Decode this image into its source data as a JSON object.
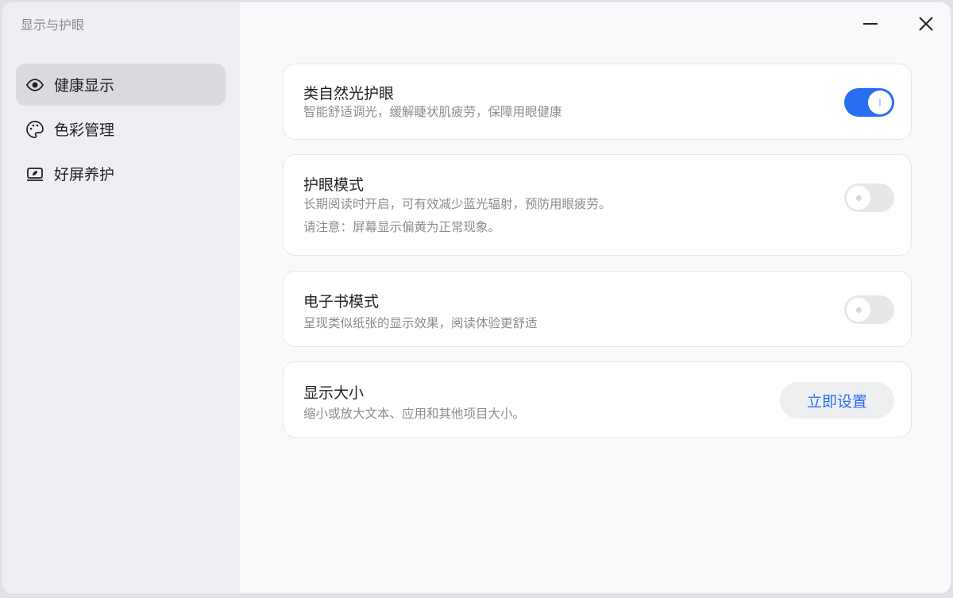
{
  "app": {
    "title": "显示与护眼"
  },
  "sidebar": {
    "items": [
      {
        "label": "健康显示",
        "icon": "eye-icon"
      },
      {
        "label": "色彩管理",
        "icon": "palette-icon"
      },
      {
        "label": "好屏养护",
        "icon": "screen-care-icon"
      }
    ]
  },
  "cards": [
    {
      "title": "类自然光护眼",
      "desc": "智能舒适调光，缓解睫状肌疲劳，保障用眼健康",
      "on": true
    },
    {
      "title": "护眼模式",
      "desc": "长期阅读时开启，可有效减少蓝光辐射，预防用眼疲劳。",
      "desc2": "请注意：屏幕显示偏黄为正常现象。",
      "on": false
    },
    {
      "title": "电子书模式",
      "desc": "呈现类似纸张的显示效果，阅读体验更舒适",
      "on": false
    },
    {
      "title": "显示大小",
      "desc": "缩小或放大文本、应用和其他项目大小。",
      "button": "立即设置"
    }
  ],
  "colors": {
    "accent": "#2a6ef2"
  }
}
